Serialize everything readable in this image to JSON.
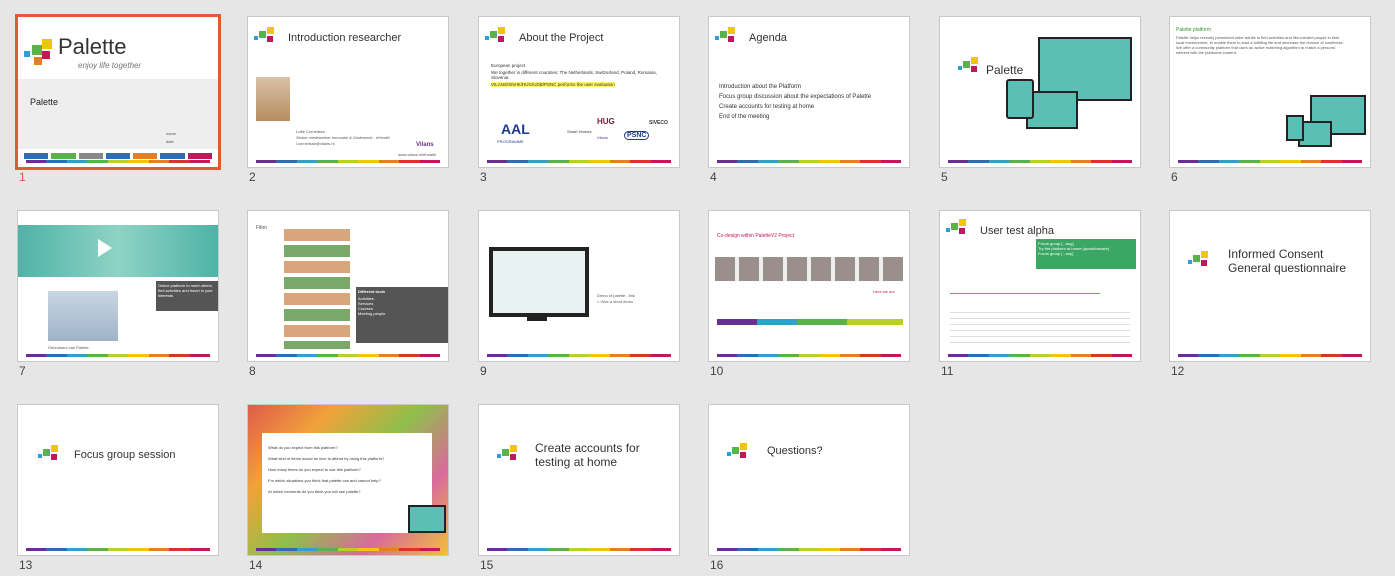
{
  "colors": {
    "selected_border": "#e2593a",
    "rainbow": [
      "#6a2d91",
      "#2e6db4",
      "#33a0c9",
      "#5ab34a",
      "#b9cf2a",
      "#f1c40f",
      "#e67e22",
      "#d9342b",
      "#c2185b"
    ]
  },
  "slides": [
    {
      "num": "1",
      "title": "Palette",
      "tagline": "enjoy life together",
      "subtitle": "Palette",
      "fields": [
        "name",
        "date"
      ]
    },
    {
      "num": "2",
      "title": "Introduction researcher",
      "name": "Lotte Cornelisse",
      "role": "Senior medewerker Innovatie & Onderzoek - eHealth",
      "email": "l.cornelisse@vilans.nl",
      "org": "Vilans",
      "url": "www.vilans.nl/ehealth"
    },
    {
      "num": "3",
      "title": "About the Project",
      "bullets": [
        "European project",
        "We together in different countries; The Netherlands, Switzerland, Poland, Romania, Slovenia.",
        "VILANS/SNHK/HUG/UDB/PSNC performs the user evaluation"
      ],
      "logos": [
        "AAL",
        "PROGRAMME",
        "HUG",
        "Smart Homes",
        "Vilans",
        "PSNC",
        "SIVECO"
      ]
    },
    {
      "num": "4",
      "title": "Agenda",
      "bullets": [
        "Introduction about the Platform",
        "Focus group discussion about the expectations of Palette",
        "Create accounts for testing at home",
        "End of the meeting"
      ]
    },
    {
      "num": "5",
      "title": "Palette"
    },
    {
      "num": "6",
      "title": "Palette platform",
      "body": "Palette helps recently pensioned older adults to find activities and like-minded people in their local environment, to enable them to lead a fulfilling life and decrease the chance of loneliness. We offer a community platform that uses an active matching algorithm to match a persons' interest with the platforms content."
    },
    {
      "num": "7",
      "caption": "Online platform to meet others, find activities and travel in your interests",
      "label": "Gebruikers van Palette"
    },
    {
      "num": "8",
      "title": "Filter",
      "box_title": "Different tools",
      "box_items": [
        "Activities",
        "Services",
        "Courses",
        "Meeting people"
      ]
    },
    {
      "num": "9",
      "text1": "Demo of palette - link",
      "text2": "> Give a short demo"
    },
    {
      "num": "10",
      "title": "Co-design within PaletteV2 Project",
      "note": "Here we are"
    },
    {
      "num": "11",
      "title": "User test alpha",
      "callout": [
        "Focus group [...aug]",
        "Try the platform at home (questionnaire)",
        "Focus group [...sep]"
      ]
    },
    {
      "num": "12",
      "title": "Informed Consent General questionnaire"
    },
    {
      "num": "13",
      "title": "Focus group session"
    },
    {
      "num": "14",
      "bullets": [
        "What do you expect from this platform?",
        "What kind of items would be nice to attend by using this platform?",
        "How many times do you expect to use this platform?",
        "For which situations you think that palette can and cannot help?",
        "At which moments do you think you will use palette?"
      ]
    },
    {
      "num": "15",
      "title": "Create accounts for testing at home"
    },
    {
      "num": "16",
      "title": "Questions?"
    }
  ]
}
